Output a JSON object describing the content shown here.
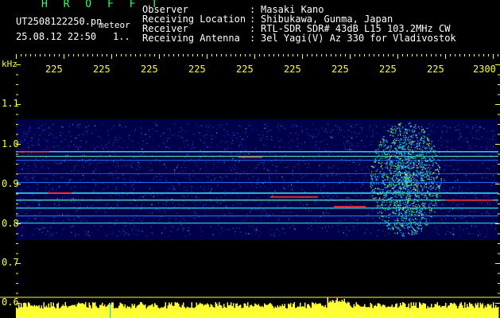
{
  "header": {
    "title": "H R O F F T",
    "filename": "UT2508122250.pn",
    "filename_suffix": "meteor",
    "datetime": "25.08.12 22:50",
    "counter": "1..",
    "info": [
      {
        "label": "Observer",
        "value": "Masaki Kano"
      },
      {
        "label": "Receiving Location",
        "value": "Shibukawa, Gunma, Japan"
      },
      {
        "label": "Receiver",
        "value": "RTL-SDR SDR# 43dB L15 103.2MHz CW"
      },
      {
        "label": "Receiving Antenna",
        "value": "3el Yagi(V) Az 330 for Vladivostok"
      }
    ]
  },
  "axes": {
    "y_unit": "kHz",
    "x_ticks": [
      "225",
      "225",
      "225",
      "225",
      "225",
      "225",
      "225",
      "225",
      "225",
      "2300"
    ],
    "y_ticks": [
      "1.1",
      "1.0",
      "0.9",
      "0.8",
      "0.7",
      "0.6"
    ]
  },
  "colors": {
    "label_yellow": "#ffff33",
    "title_green": "#33ff66",
    "noise_floor": "#00004a",
    "signal_cyan": "#29c8e0",
    "strong_red": "#ff3030"
  }
}
